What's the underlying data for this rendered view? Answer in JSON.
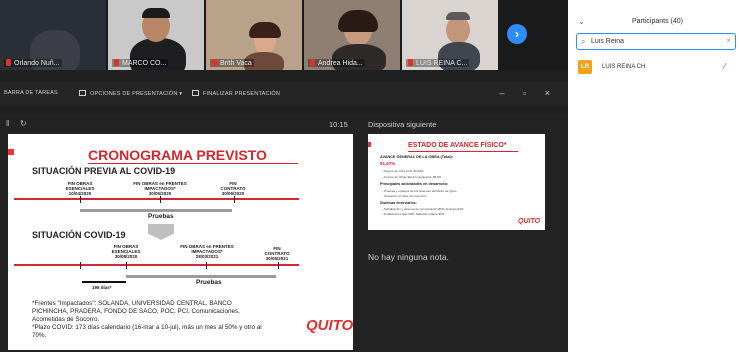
{
  "video_strip": {
    "tiles": [
      {
        "name": "Orlando Nuñ..."
      },
      {
        "name": "MARCO CO..."
      },
      {
        "name": "Brith Vaca"
      },
      {
        "name": "Andrea Hida..."
      },
      {
        "name": "LUIS REINA C..."
      }
    ],
    "next_arrow": "›"
  },
  "toolbar": {
    "items": [
      "BARRA DE TAREAS",
      "OPCIONES DE PRESENTACIÓN ▾",
      "FINALIZAR PRESENTACIÓN"
    ],
    "controls": "– ▫ ×"
  },
  "presenter": {
    "timer": "10:15",
    "next_slide_label": "Dispositiva siguiente",
    "notes": "No hay ninguna nota."
  },
  "slide": {
    "title": "CRONOGRAMA PREVISTO",
    "section1": "SITUACIÓN PREVIA AL COVID-19",
    "section2": "SITUACIÓN COVID-19",
    "m1": [
      "FIN OBRAS",
      "ESENCIALES",
      "10/04/2020"
    ],
    "m2": [
      "FIN OBRAS en FRENTES",
      "IMPACTADOS*",
      "30/05/2020"
    ],
    "m3": [
      "FIN",
      "CONTRATO",
      "30/06/2020"
    ],
    "pruebas1": "Pruebas",
    "m4": [
      "FIN OBRAS",
      "ESENCIALES",
      "30/08/2020"
    ],
    "m5": [
      "FIN OBRAS en FRENTES",
      "IMPACTADOS*",
      "28/03/2021"
    ],
    "m6": [
      "FIN",
      "CONTRATO",
      "30/05/2021"
    ],
    "pruebas2": "Pruebas",
    "days": "195 días*",
    "footnote1": "*Frentes \"Impactados\": SOLANDA, UNIVERSIDAD CENTRAL, BANCO",
    "footnote2": "PICHINCHA, PRADERA, FONDO DE SACO, POC, PCI, Comunicaciones,",
    "footnote3": "Acometidas de Socorro.",
    "footnote4": "*Plazo COVID: 173 días calendario (16-mar a 10-jul), más un mes al 50% y otro al",
    "footnote5": "70%.",
    "logo": "QUITO"
  },
  "next_slide": {
    "title": "ESTADO DE AVANCE FÍSICO*",
    "line1": "AVANCE GENERAL DE LA OBRA (Total):",
    "pct": "91,67%",
    "line2": "- Avance de Obra Civil: 96,49%",
    "line3": "- Avance de Obras Electromecánicas: 86,6%",
    "heading2": "Principales actividades en desarrollo:",
    "line4": "- Pruebas y ensayos de los sistemas del Metro de Quito",
    "line5": "- Operación en fase de recepción",
    "heading3": "Sistemas ferroviarios:",
    "line6": "- Señalización y sistema de comunicación 85%, Energía 92%",
    "line7": "- Instalaciones fijas 90%, Material rodante 98%",
    "logo": "QUITO"
  },
  "participants": {
    "title": "Participants (40)",
    "search_value": "Luis Reina",
    "results": [
      {
        "initials": "LR",
        "name": "LUIS REINA CH."
      }
    ]
  }
}
